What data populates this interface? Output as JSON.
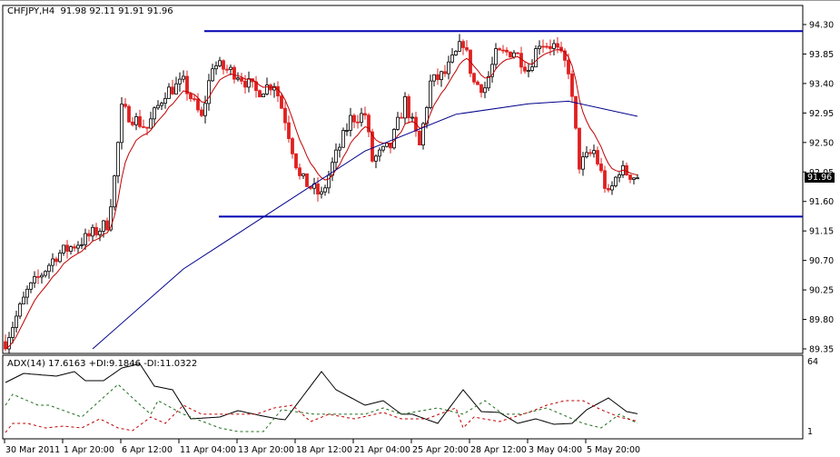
{
  "header": {
    "symbol": "CHFJPY,H4",
    "ohlc": "91.98 92.11 91.91 91.96"
  },
  "indicator": {
    "label": "ADX(14) 17.6163 +DI:9.1846 -DI:11.0322",
    "scale_max": "64",
    "scale_min": "1"
  },
  "current_price": "91.96",
  "colors": {
    "bull": "#ffffff",
    "bear": "#e02020",
    "ma_fast": "#c00000",
    "ma_slow": "#00008b",
    "level": "#0000b0",
    "adx": "#000000",
    "plus_di": "#1e6e1e",
    "minus_di": "#c00000"
  },
  "chart_data": [
    {
      "type": "candlestick",
      "title": "CHFJPY,H4",
      "bars": 175,
      "ylim": [
        89.35,
        94.3
      ],
      "yticks": [
        "94.30",
        "93.85",
        "93.40",
        "92.95",
        "92.50",
        "92.05",
        "91.60",
        "91.15",
        "90.70",
        "90.25",
        "89.80",
        "89.35"
      ],
      "xticks": [
        {
          "bar": 0,
          "label": "30 Mar 2011"
        },
        {
          "bar": 16,
          "label": "1 Apr 20:00"
        },
        {
          "bar": 32,
          "label": "6 Apr 12:00"
        },
        {
          "bar": 48,
          "label": "11 Apr 04:00"
        },
        {
          "bar": 64,
          "label": "13 Apr 20:00"
        },
        {
          "bar": 80,
          "label": "18 Apr 12:00"
        },
        {
          "bar": 96,
          "label": "21 Apr 04:00"
        },
        {
          "bar": 112,
          "label": "25 Apr 20:00"
        },
        {
          "bar": 128,
          "label": "28 Apr 12:00"
        },
        {
          "bar": 144,
          "label": "3 May 04:00"
        },
        {
          "bar": 160,
          "label": "5 May 20:00"
        }
      ],
      "close_anchors": [
        [
          0,
          89.46
        ],
        [
          6,
          90.22
        ],
        [
          14,
          90.78
        ],
        [
          22,
          91.03
        ],
        [
          28,
          91.26
        ],
        [
          30,
          91.96
        ],
        [
          32,
          93.0
        ],
        [
          39,
          92.72
        ],
        [
          44,
          93.27
        ],
        [
          49,
          93.41
        ],
        [
          54,
          92.86
        ],
        [
          57,
          93.69
        ],
        [
          64,
          93.55
        ],
        [
          69,
          93.27
        ],
        [
          74,
          93.41
        ],
        [
          77,
          92.86
        ],
        [
          81,
          91.96
        ],
        [
          87,
          91.68
        ],
        [
          90,
          92.16
        ],
        [
          95,
          92.86
        ],
        [
          99,
          92.93
        ],
        [
          101,
          92.23
        ],
        [
          106,
          92.44
        ],
        [
          110,
          93.13
        ],
        [
          114,
          92.44
        ],
        [
          117,
          93.41
        ],
        [
          121,
          93.55
        ],
        [
          126,
          94.04
        ],
        [
          129,
          93.41
        ],
        [
          132,
          93.34
        ],
        [
          135,
          93.83
        ],
        [
          140,
          93.9
        ],
        [
          144,
          93.62
        ],
        [
          147,
          94.04
        ],
        [
          151,
          93.97
        ],
        [
          155,
          93.62
        ],
        [
          158,
          92.16
        ],
        [
          162,
          92.37
        ],
        [
          166,
          91.68
        ],
        [
          169,
          92.09
        ],
        [
          174,
          91.96
        ]
      ],
      "ma_slow": [
        [
          24,
          89.35
        ],
        [
          49,
          90.57
        ],
        [
          74,
          91.47
        ],
        [
          99,
          92.37
        ],
        [
          124,
          92.93
        ],
        [
          144,
          93.09
        ],
        [
          155,
          93.13
        ],
        [
          174,
          92.9
        ]
      ],
      "levels": [
        {
          "price": 94.2,
          "from_bar": 55
        },
        {
          "price": 91.37,
          "from_bar": 59
        }
      ]
    },
    {
      "type": "line",
      "title": "ADX(14)",
      "ylim": [
        1,
        64
      ],
      "series": [
        {
          "name": "ADX",
          "points": [
            [
              0,
              45.4
            ],
            [
              5,
              53.5
            ],
            [
              14,
              51.1
            ],
            [
              19,
              55.1
            ],
            [
              22,
              47.0
            ],
            [
              27,
              47.0
            ],
            [
              32,
              58.3
            ],
            [
              37,
              62
            ],
            [
              41,
              42.2
            ],
            [
              46,
              39.0
            ],
            [
              51,
              13.1
            ],
            [
              59,
              14.7
            ],
            [
              64,
              20.4
            ],
            [
              71,
              15.5
            ],
            [
              75,
              13.1
            ],
            [
              77,
              12.3
            ],
            [
              87,
              55.1
            ],
            [
              91,
              39.0
            ],
            [
              99,
              25.2
            ],
            [
              104,
              29.3
            ],
            [
              109,
              17.2
            ],
            [
              112,
              17.2
            ],
            [
              119,
              9.1
            ],
            [
              126,
              39.0
            ],
            [
              131,
              19.6
            ],
            [
              136,
              18.8
            ],
            [
              141,
              9.1
            ],
            [
              146,
              13.1
            ],
            [
              151,
              8.3
            ],
            [
              156,
              9.1
            ],
            [
              160,
              21.2
            ],
            [
              166,
              31.7
            ],
            [
              171,
              19.6
            ],
            [
              174,
              17.6
            ]
          ]
        },
        {
          "name": "+DI",
          "points": [
            [
              0,
              25.2
            ],
            [
              2,
              34.9
            ],
            [
              9,
              25.2
            ],
            [
              12,
              25.2
            ],
            [
              21,
              14.7
            ],
            [
              26,
              29.3
            ],
            [
              31,
              43.8
            ],
            [
              35,
              31.7
            ],
            [
              40,
              17.2
            ],
            [
              42,
              29.3
            ],
            [
              49,
              17.2
            ],
            [
              59,
              5.0
            ],
            [
              64,
              1.8
            ],
            [
              71,
              1.8
            ],
            [
              76,
              21.2
            ],
            [
              85,
              17.2
            ],
            [
              94,
              17.2
            ],
            [
              99,
              17.2
            ],
            [
              104,
              22.8
            ],
            [
              109,
              17.2
            ],
            [
              119,
              22.8
            ],
            [
              126,
              17.2
            ],
            [
              132,
              29.3
            ],
            [
              137,
              17.2
            ],
            [
              142,
              17.2
            ],
            [
              149,
              22.8
            ],
            [
              159,
              9.1
            ],
            [
              164,
              5.0
            ],
            [
              169,
              17.2
            ],
            [
              174,
              9.2
            ]
          ]
        },
        {
          "name": "-DI",
          "points": [
            [
              0,
              1
            ],
            [
              2,
              9.1
            ],
            [
              6,
              9.1
            ],
            [
              11,
              5.0
            ],
            [
              16,
              6.7
            ],
            [
              21,
              5.0
            ],
            [
              26,
              13.1
            ],
            [
              31,
              5.0
            ],
            [
              35,
              2.6
            ],
            [
              40,
              14.7
            ],
            [
              44,
              9.1
            ],
            [
              49,
              25.2
            ],
            [
              54,
              17.2
            ],
            [
              60,
              17.2
            ],
            [
              69,
              17.2
            ],
            [
              74,
              22.8
            ],
            [
              79,
              25.2
            ],
            [
              84,
              10.7
            ],
            [
              89,
              17.2
            ],
            [
              96,
              13.1
            ],
            [
              104,
              18.8
            ],
            [
              109,
              13.1
            ],
            [
              116,
              13.1
            ],
            [
              124,
              22.8
            ],
            [
              126,
              5.0
            ],
            [
              129,
              14.7
            ],
            [
              136,
              10.7
            ],
            [
              144,
              18.8
            ],
            [
              149,
              25.2
            ],
            [
              154,
              29.3
            ],
            [
              159,
              29.3
            ],
            [
              164,
              21.2
            ],
            [
              169,
              14.7
            ],
            [
              174,
              11.0
            ]
          ]
        }
      ]
    }
  ]
}
